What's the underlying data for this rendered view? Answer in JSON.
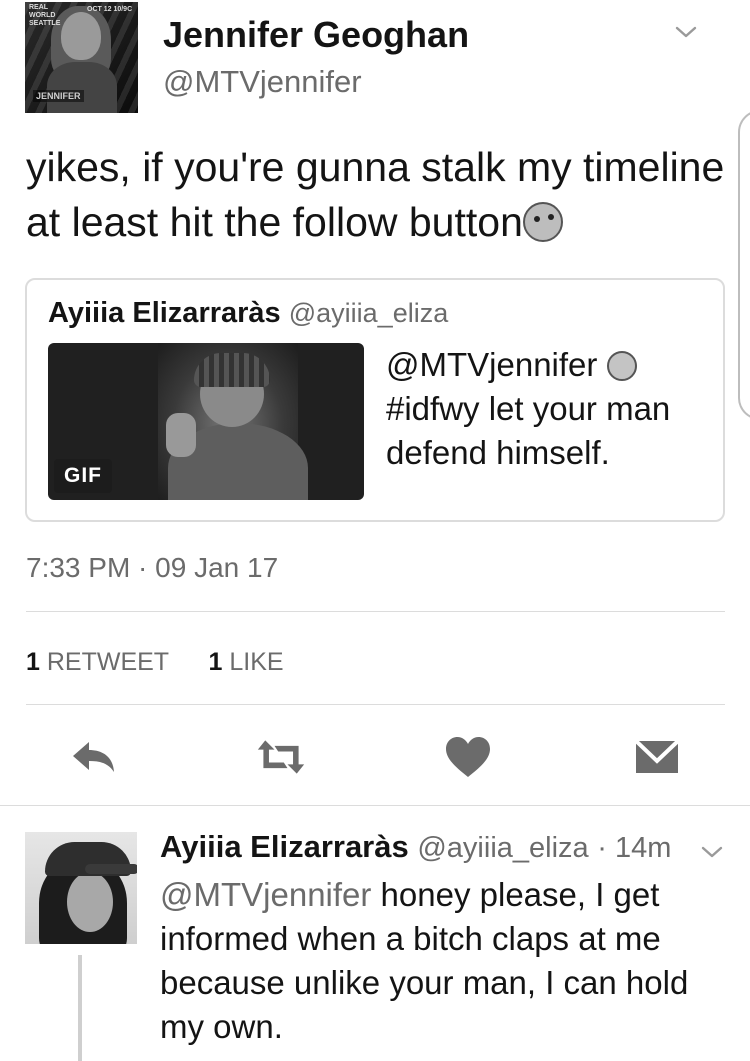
{
  "tweet": {
    "author": {
      "display_name": "Jennifer Geoghan",
      "handle": "@MTVjennifer"
    },
    "avatar": {
      "line1": "REAL WORLD",
      "line2": "SEATTLE",
      "date": "OCT 12 10/9C",
      "name": "JENNIFER"
    },
    "text": "yikes, if you're gunna stalk my timeline at least hit the follow button",
    "emoji": "kissing-face-emoji",
    "quoted": {
      "display_name": "Ayiiia Elizarraràs",
      "handle": "@ayiiia_eliza",
      "media_badge": "GIF",
      "text_mention": "@MTVjennifer",
      "text_emoji": "laughing-face-emoji",
      "text_rest": "#idfwy let your man defend himself."
    },
    "timestamp": "7:33 PM · 09 Jan 17",
    "stats": {
      "retweets_count": "1",
      "retweets_label": "RETWEET",
      "likes_count": "1",
      "likes_label": "LIKE"
    },
    "actions": [
      "reply-icon",
      "retweet-icon",
      "like-heart-icon",
      "direct-message-icon"
    ]
  },
  "reply": {
    "display_name": "Ayiiia Elizarraràs",
    "handle": "@ayiiia_eliza",
    "time": "· 14m",
    "mention": "@MTVjennifer",
    "text": " honey please, I get informed when a bitch claps at me because unlike your man, I can hold my own."
  },
  "colors": {
    "text": "#141414",
    "secondary": "#6b6b6b",
    "divider": "#dcdcdc"
  }
}
